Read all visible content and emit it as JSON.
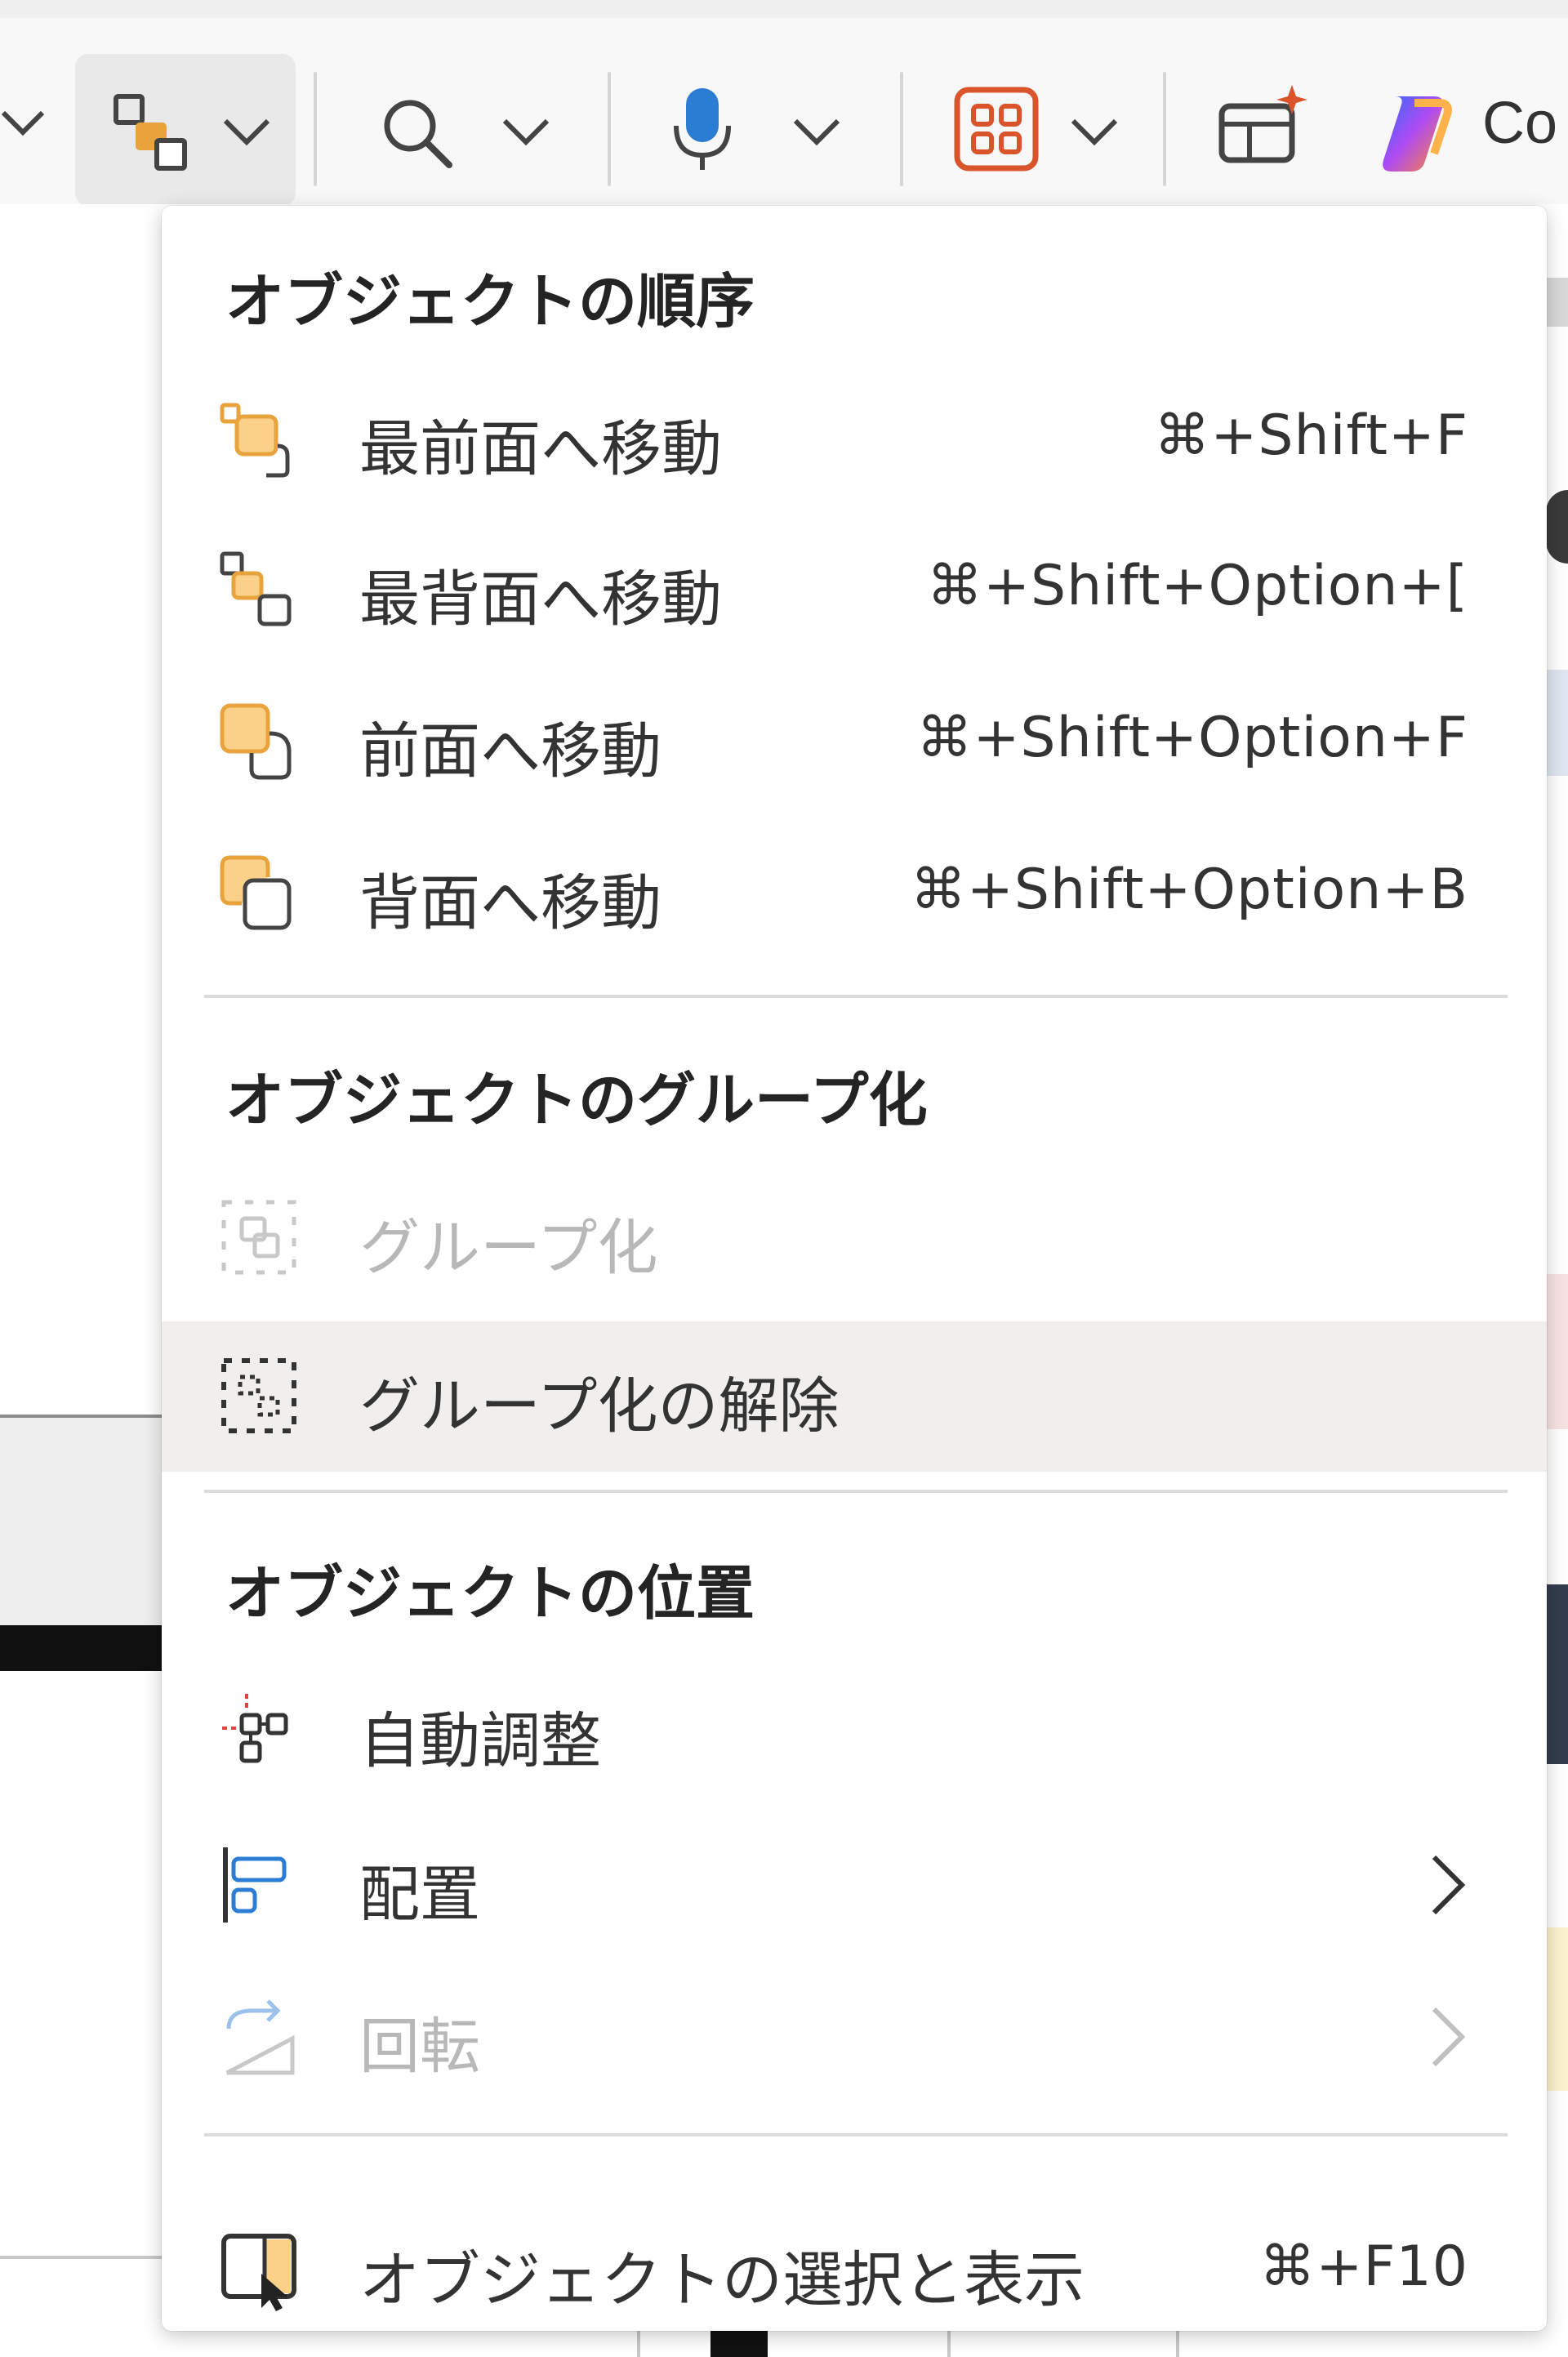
{
  "toolbar": {
    "copilot_label": "Co",
    "items": [
      {
        "icon": "chevron-down-icon"
      },
      {
        "icon": "arrange-objects-icon",
        "active": true
      },
      {
        "icon": "search-icon"
      },
      {
        "icon": "microphone-icon"
      },
      {
        "icon": "add-ins-grid-icon"
      },
      {
        "icon": "designer-icon"
      },
      {
        "icon": "copilot-icon"
      }
    ]
  },
  "menu": {
    "sections": {
      "order": {
        "header": "オブジェクトの順序",
        "items": [
          {
            "label": "最前面へ移動",
            "shortcut": "⌘+Shift+F",
            "icon": "bring-to-front-icon"
          },
          {
            "label": "最背面へ移動",
            "shortcut": "⌘+Shift+Option+[",
            "icon": "send-to-back-icon"
          },
          {
            "label": "前面へ移動",
            "shortcut": "⌘+Shift+Option+F",
            "icon": "bring-forward-icon"
          },
          {
            "label": "背面へ移動",
            "shortcut": "⌘+Shift+Option+B",
            "icon": "send-backward-icon"
          }
        ]
      },
      "group": {
        "header": "オブジェクトのグループ化",
        "items": [
          {
            "label": "グループ化",
            "icon": "group-icon",
            "disabled": true
          },
          {
            "label": "グループ化の解除",
            "icon": "ungroup-icon",
            "hovered": true
          }
        ]
      },
      "position": {
        "header": "オブジェクトの位置",
        "items": [
          {
            "label": "自動調整",
            "icon": "auto-fit-icon"
          },
          {
            "label": "配置",
            "icon": "align-icon",
            "submenu": true
          },
          {
            "label": "回転",
            "icon": "rotate-icon",
            "submenu": true,
            "disabled": true
          }
        ]
      },
      "selection": {
        "items": [
          {
            "label": "オブジェクトの選択と表示",
            "shortcut": "⌘+F10",
            "icon": "selection-pane-icon"
          }
        ]
      }
    }
  },
  "colors": {
    "accent_orange": "#e8a33c",
    "accent_blue": "#2b7cd3",
    "hover_bg": "#f0efee",
    "disabled_text": "#b8b8b8"
  }
}
